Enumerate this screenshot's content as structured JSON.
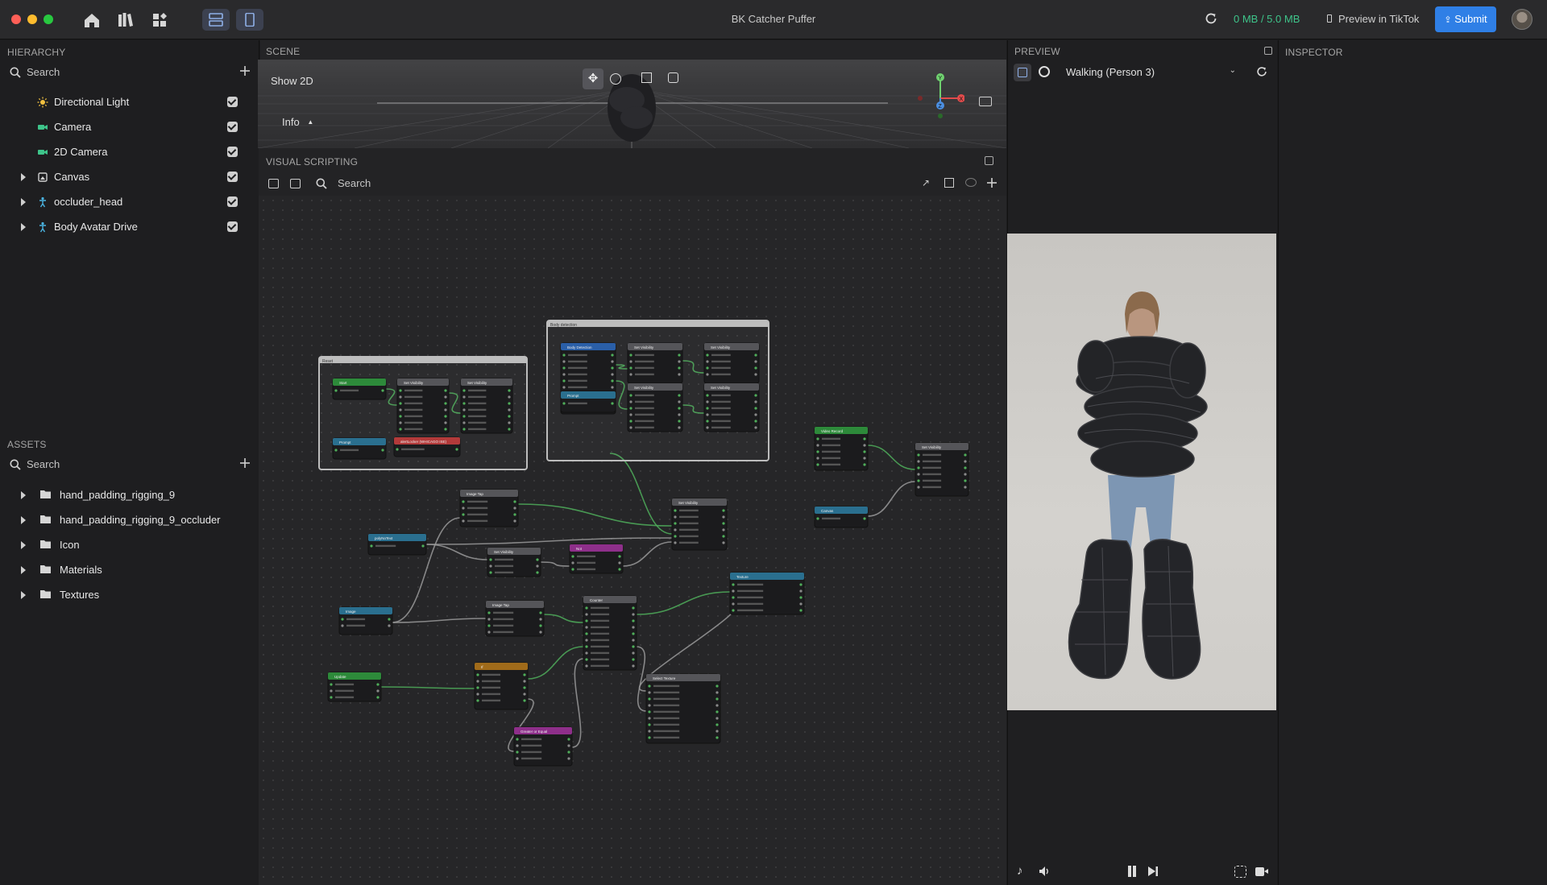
{
  "window": {
    "title": "BK Catcher Puffer",
    "storage": "0 MB / 5.0 MB",
    "preview_in_tiktok": "Preview in TikTok",
    "submit": "Submit"
  },
  "hierarchy": {
    "title": "HIERARCHY",
    "search_placeholder": "Search",
    "items": [
      {
        "label": "Directional Light",
        "icon": "sun-icon",
        "expandable": false,
        "checked": true
      },
      {
        "label": "Camera",
        "icon": "camera-icon",
        "expandable": false,
        "checked": true
      },
      {
        "label": "2D Camera",
        "icon": "camera-icon",
        "expandable": false,
        "checked": true
      },
      {
        "label": "Canvas",
        "icon": "canvas-icon",
        "expandable": true,
        "checked": true
      },
      {
        "label": "occluder_head",
        "icon": "person-icon",
        "expandable": true,
        "checked": true
      },
      {
        "label": "Body Avatar Drive",
        "icon": "person-icon",
        "expandable": true,
        "checked": true
      }
    ]
  },
  "assets": {
    "title": "ASSETS",
    "search_placeholder": "Search",
    "items": [
      {
        "label": "hand_padding_rigging_9",
        "icon": "folder-icon"
      },
      {
        "label": "hand_padding_rigging_9_occluder",
        "icon": "folder-icon"
      },
      {
        "label": "Icon",
        "icon": "folder-icon"
      },
      {
        "label": "Materials",
        "icon": "folder-icon"
      },
      {
        "label": "Textures",
        "icon": "folder-icon"
      }
    ]
  },
  "scene": {
    "title": "SCENE",
    "show_2d": "Show 2D",
    "info": "Info"
  },
  "visual_scripting": {
    "title": "VISUAL SCRIPTING",
    "search_placeholder": "Search",
    "groups": [
      {
        "label": "Reset"
      },
      {
        "label": "Body detection"
      }
    ],
    "nodes": [
      {
        "label": "Start",
        "color": "#2d8a3a"
      },
      {
        "label": "Set Visibility",
        "color": "#555559"
      },
      {
        "label": "Set Visibility",
        "color": "#555559"
      },
      {
        "label": "Prompt",
        "color": "#2a6f8f"
      },
      {
        "label": "alertLocker (WHICAGO ISE)",
        "color": "#b33a3a"
      },
      {
        "label": "Body Detection",
        "color": "#2a5fa8"
      },
      {
        "label": "Set Visibility",
        "color": "#555559"
      },
      {
        "label": "Set Visibility",
        "color": "#555559"
      },
      {
        "label": "Set Visibility",
        "color": "#555559"
      },
      {
        "label": "Set Visibility",
        "color": "#555559"
      },
      {
        "label": "Prompt",
        "color": "#2a6f8f"
      },
      {
        "label": "Video Record",
        "color": "#2d8a3a"
      },
      {
        "label": "Set Visibility",
        "color": "#555559"
      },
      {
        "label": "Canvas",
        "color": "#2a6f8f"
      },
      {
        "label": "Image Tap",
        "color": "#555559"
      },
      {
        "label": "Set Visibility",
        "color": "#555559"
      },
      {
        "label": "polyNoText",
        "color": "#2a6f8f"
      },
      {
        "label": "Set Visibility",
        "color": "#555559"
      },
      {
        "label": "Not",
        "color": "#8e2f8a"
      },
      {
        "label": "Image",
        "color": "#2a6f8f"
      },
      {
        "label": "Image Tap",
        "color": "#555559"
      },
      {
        "label": "Counter",
        "color": "#555559"
      },
      {
        "label": "Texture",
        "color": "#2a6f8f"
      },
      {
        "label": "Update",
        "color": "#2d8a3a"
      },
      {
        "label": "If",
        "color": "#a06b1a"
      },
      {
        "label": "Select Texture",
        "color": "#555559"
      },
      {
        "label": "Greater or Equal",
        "color": "#8e2f8a"
      }
    ]
  },
  "preview": {
    "title": "PREVIEW",
    "subject": "Walking (Person 3)"
  },
  "inspector": {
    "title": "INSPECTOR"
  },
  "colors": {
    "accent": "#2f7fe6",
    "storage_green": "#3ec48a",
    "checkbox": "#cfcfcf"
  }
}
